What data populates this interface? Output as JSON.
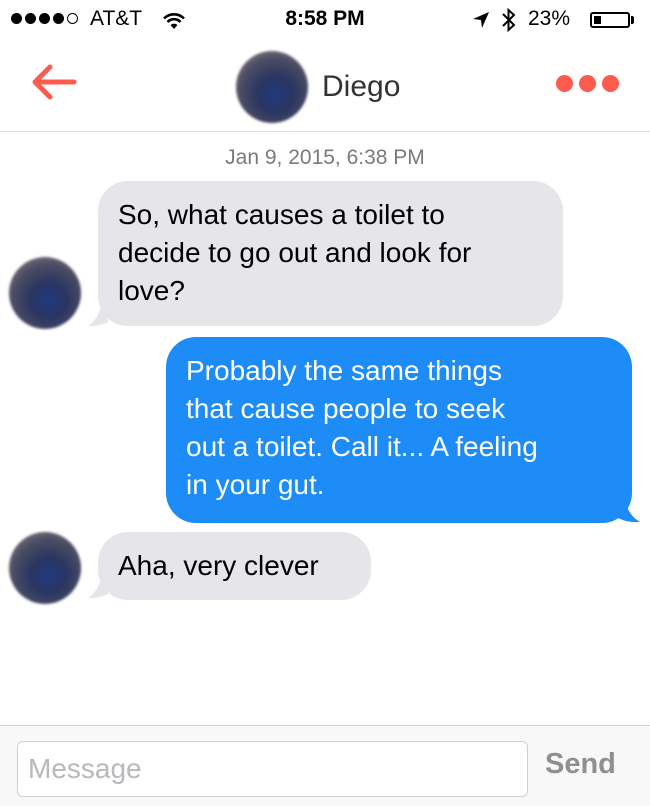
{
  "status_bar": {
    "carrier": "AT&T",
    "time": "8:58 PM",
    "battery_percent": "23%",
    "battery_level": 0.23,
    "signal_bars": 4,
    "icons": [
      "signal-dots-icon",
      "wifi-icon",
      "location-arrow-icon",
      "bluetooth-icon",
      "battery-icon"
    ]
  },
  "header": {
    "contact_name": "Diego",
    "back_icon": "back-arrow-icon",
    "more_icon": "more-dots-icon",
    "accent_color": "#fd5b4e"
  },
  "conversation": {
    "timestamp": "Jan 9, 2015, 6:38 PM",
    "messages": [
      {
        "direction": "received",
        "text": "So, what causes a toilet to\ndecide to go out and look for\nlove?"
      },
      {
        "direction": "sent",
        "text": "Probably the same things\nthat cause people to seek\nout a toilet. Call it... A feeling\nin your gut."
      },
      {
        "direction": "received",
        "text": "Aha, very clever"
      }
    ],
    "colors": {
      "received_bubble": "#e5e5ea",
      "sent_bubble": "#1e8cf6"
    }
  },
  "composer": {
    "placeholder": "Message",
    "send_label": "Send"
  }
}
